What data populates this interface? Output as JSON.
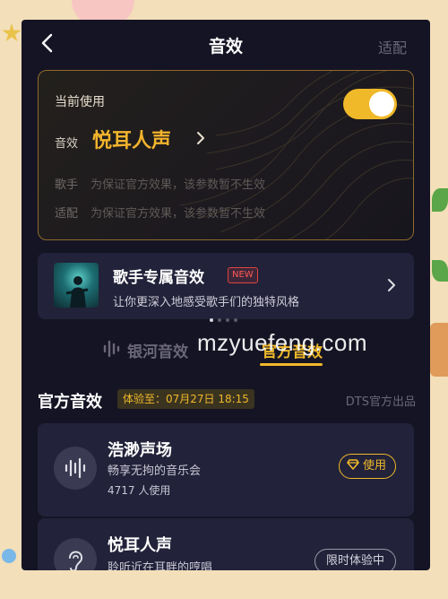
{
  "nav": {
    "title": "音效",
    "right": "适配"
  },
  "current": {
    "label": "当前使用",
    "effect_label": "音效",
    "effect_value": "悦耳人声",
    "singer_label": "歌手",
    "singer_note": "为保证官方效果，该参数暂不生效",
    "adapt_label": "适配",
    "adapt_note": "为保证官方效果，该参数暂不生效",
    "toggle_on": true
  },
  "promo": {
    "title": "歌手专属音效",
    "badge": "NEW",
    "subtitle": "让你更深入地感受歌手们的独特风格",
    "page_count": 4,
    "active_page": 1
  },
  "tabs": [
    {
      "label": "银河音效",
      "active": false
    },
    {
      "label": "官方音效",
      "active": true
    }
  ],
  "watermark": "mzyuefeng.com",
  "section": {
    "title": "官方音效",
    "trial": "体验至：07月27日 18:15",
    "right": "DTS官方出品"
  },
  "effects": [
    {
      "name": "浩渺声场",
      "desc": "畅享无拘的音乐会",
      "users": "4717 人使用",
      "action": "使用",
      "icon": "waveform-icon"
    },
    {
      "name": "悦耳人声",
      "desc": "聆听近在耳畔的哼唱",
      "action": "限时体验中",
      "icon": "ear-icon"
    }
  ],
  "colors": {
    "accent": "#f0b92a",
    "background": "#151424",
    "card": "#22223a",
    "badge_red": "#e0453d"
  }
}
